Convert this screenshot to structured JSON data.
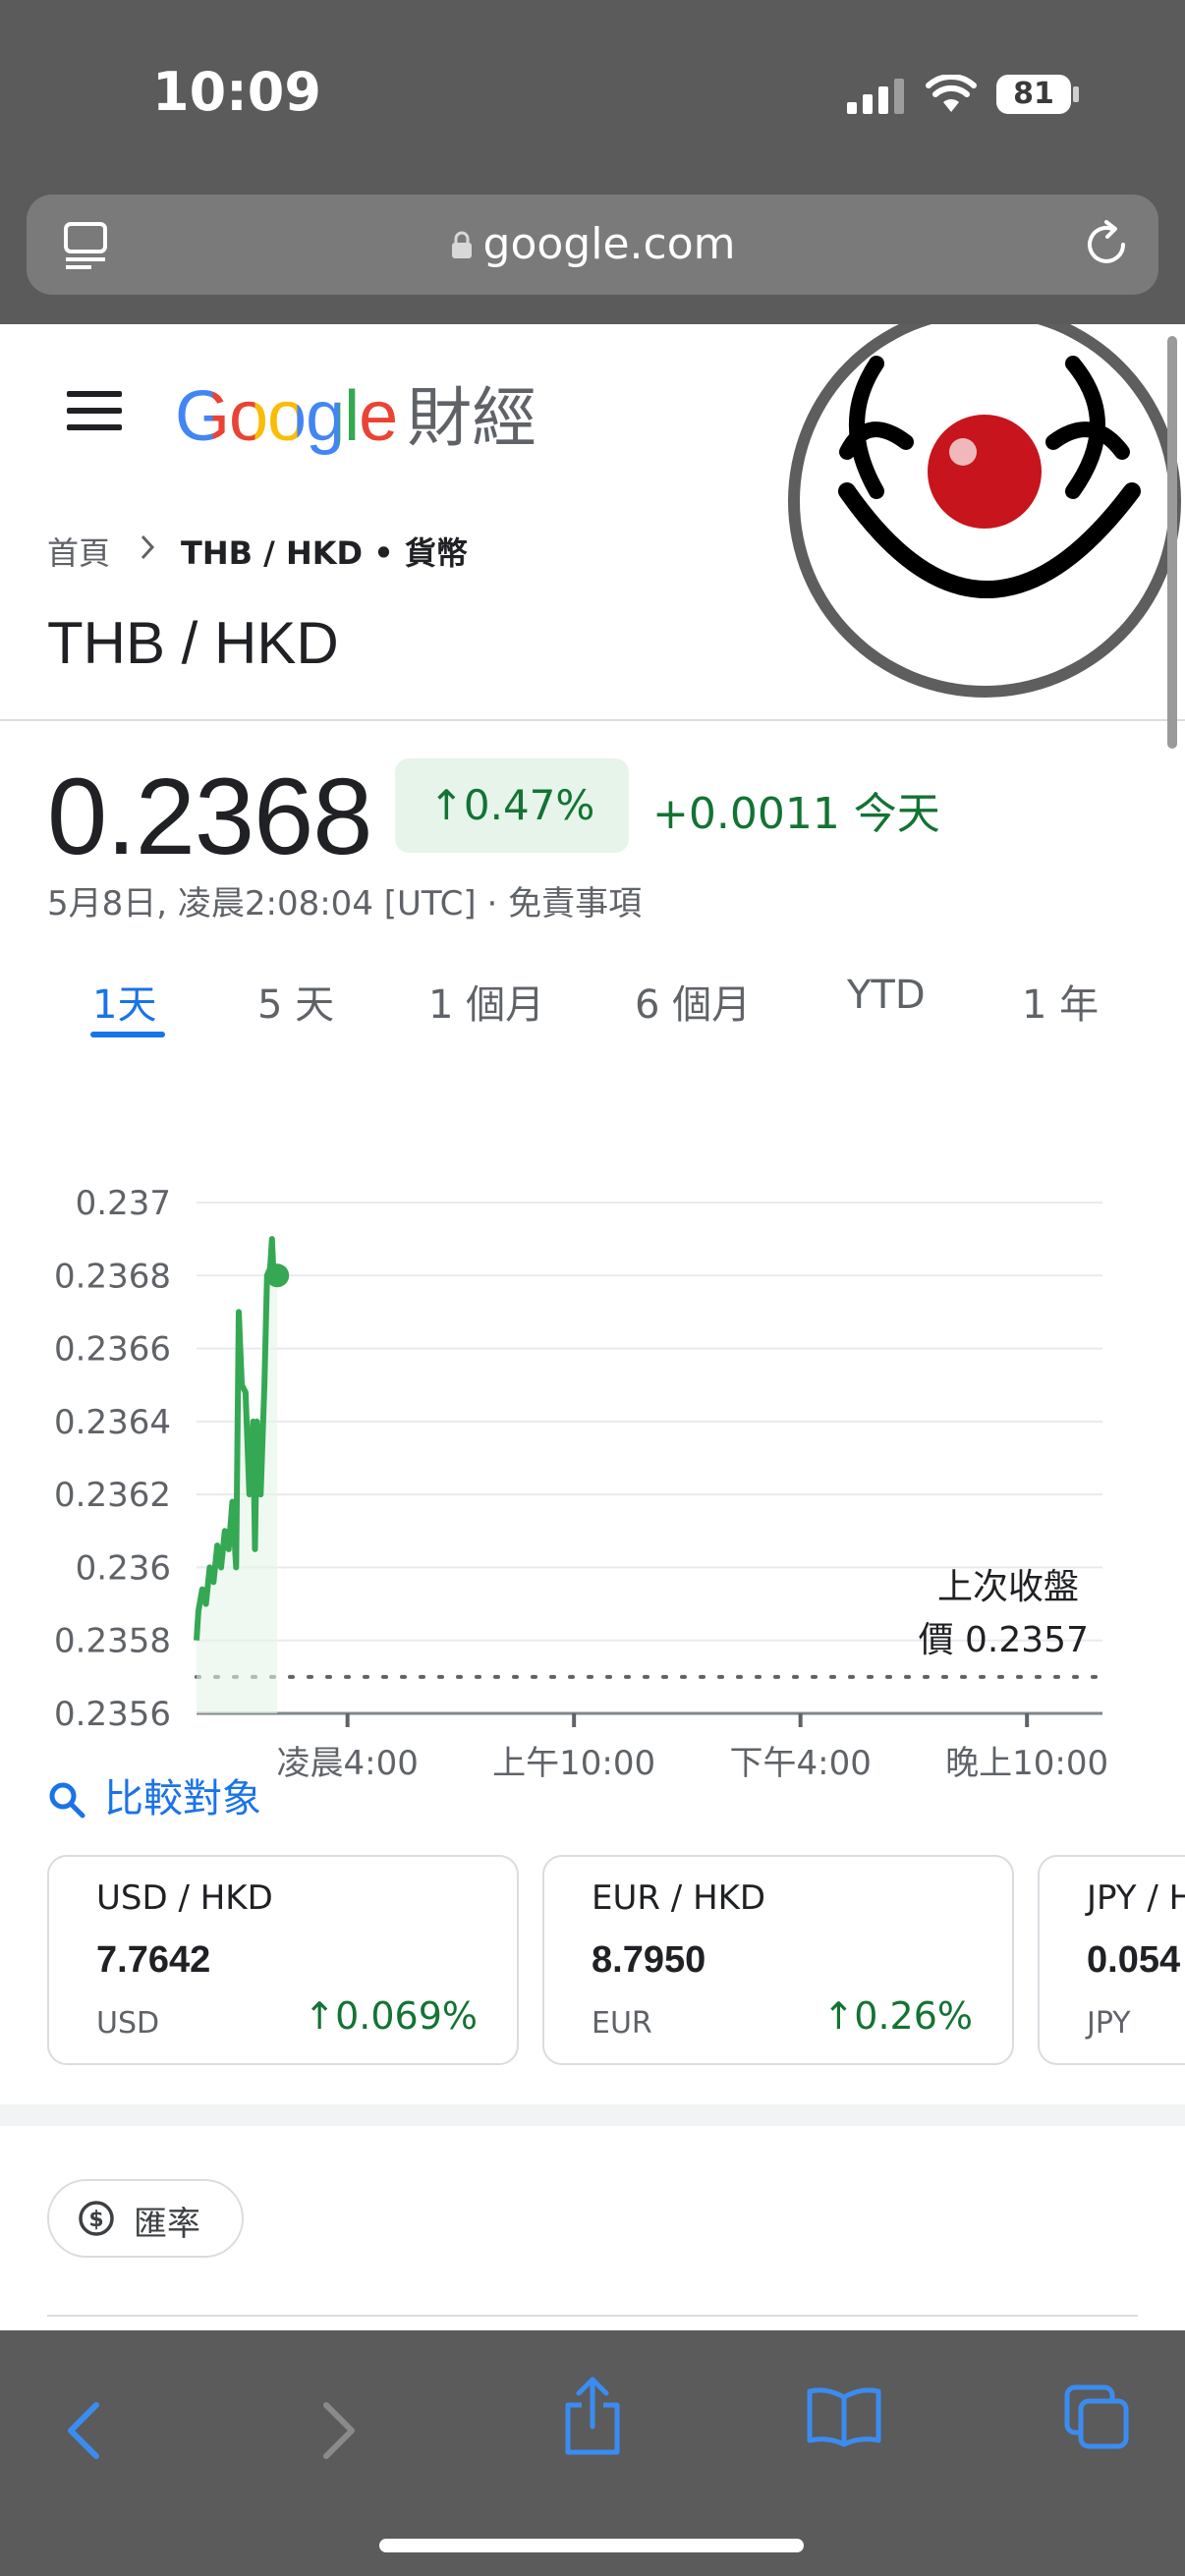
{
  "status_bar": {
    "time": "10:09",
    "battery": "81"
  },
  "url_bar": {
    "domain": "google.com"
  },
  "header": {
    "logo_text": "Google",
    "logo_suffix": "財經"
  },
  "breadcrumb": {
    "home": "首頁",
    "pair": "THB / HKD",
    "sep": "•",
    "category": "貨幣"
  },
  "quote": {
    "title": "THB / HKD",
    "price": "0.2368",
    "change_pct": "0.47%",
    "change_abs": "+0.0011 今天",
    "timestamp": "5月8日, 凌晨2:08:04 [UTC] · 免責事項"
  },
  "tabs": [
    "1天",
    "5 天",
    "1 個月",
    "6 個月",
    "YTD",
    "1 年"
  ],
  "chart_data": {
    "type": "line",
    "title": "",
    "ylim": [
      0.2356,
      0.237
    ],
    "y_ticks": [
      "0.237",
      "0.2368",
      "0.2366",
      "0.2364",
      "0.2362",
      "0.236",
      "0.2358",
      "0.2356"
    ],
    "x_ticks": [
      "凌晨4:00",
      "上午10:00",
      "下午4:00",
      "晚上10:00"
    ],
    "x_hours_range": [
      0,
      24
    ],
    "previous_close": 0.2357,
    "previous_close_label_1": "上次收盤",
    "previous_close_label_2": "價 0.2357",
    "series": [
      {
        "x": [
          0.0,
          0.05,
          0.15,
          0.25,
          0.35,
          0.45,
          0.55,
          0.65,
          0.75,
          0.85,
          0.95,
          1.05,
          1.12,
          1.2,
          1.3,
          1.4,
          1.5,
          1.55,
          1.6,
          1.7,
          1.8,
          1.87,
          1.95,
          2.0,
          2.05,
          2.1,
          2.14
        ],
        "y": [
          0.2358,
          0.23588,
          0.23594,
          0.2359,
          0.236,
          0.23596,
          0.23606,
          0.236,
          0.2361,
          0.23605,
          0.23618,
          0.236,
          0.2367,
          0.2365,
          0.23648,
          0.2362,
          0.2364,
          0.23605,
          0.2364,
          0.2362,
          0.2365,
          0.2368,
          0.23682,
          0.2369,
          0.23678,
          0.23682,
          0.2368
        ]
      }
    ],
    "colors": {
      "line": "#34a853",
      "grid": "#e8eaed",
      "axis": "#5f6368"
    }
  },
  "compare": {
    "label": "比較對象"
  },
  "cards": [
    {
      "name": "USD / HKD",
      "value": "7.7642",
      "currency": "USD",
      "change": "0.069%"
    },
    {
      "name": "EUR / HKD",
      "value": "8.7950",
      "currency": "EUR",
      "change": "0.26%"
    },
    {
      "name": "JPY / HKD",
      "value": "0.054",
      "currency": "JPY",
      "change": ""
    }
  ],
  "chip": {
    "label": "匯率"
  },
  "colors": {
    "up": "#137333",
    "accent": "#1a73e8",
    "chrome": "#5b5b5b"
  }
}
